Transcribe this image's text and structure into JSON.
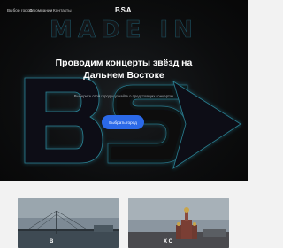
{
  "nav": {
    "items": [
      {
        "label": "Выбор города"
      },
      {
        "label": "О компании"
      },
      {
        "label": "Контакты"
      }
    ],
    "logo": "BSA"
  },
  "hero": {
    "background_text": "MADE IN",
    "background_logo": "BSA",
    "headline_line1": "Проводим концерты звёзд на",
    "headline_line2": "Дальнем Востоке",
    "subtitle": "Выберите свой город и узнайте о предстоящих концертах",
    "cta_label": "Выбрать город"
  },
  "cities": [
    {
      "label": "В"
    },
    {
      "label": "Х   С"
    }
  ],
  "colors": {
    "hero_bg": "#0c0d0e",
    "accent": "#2b69e8",
    "page_bg": "#f2f2f2"
  }
}
